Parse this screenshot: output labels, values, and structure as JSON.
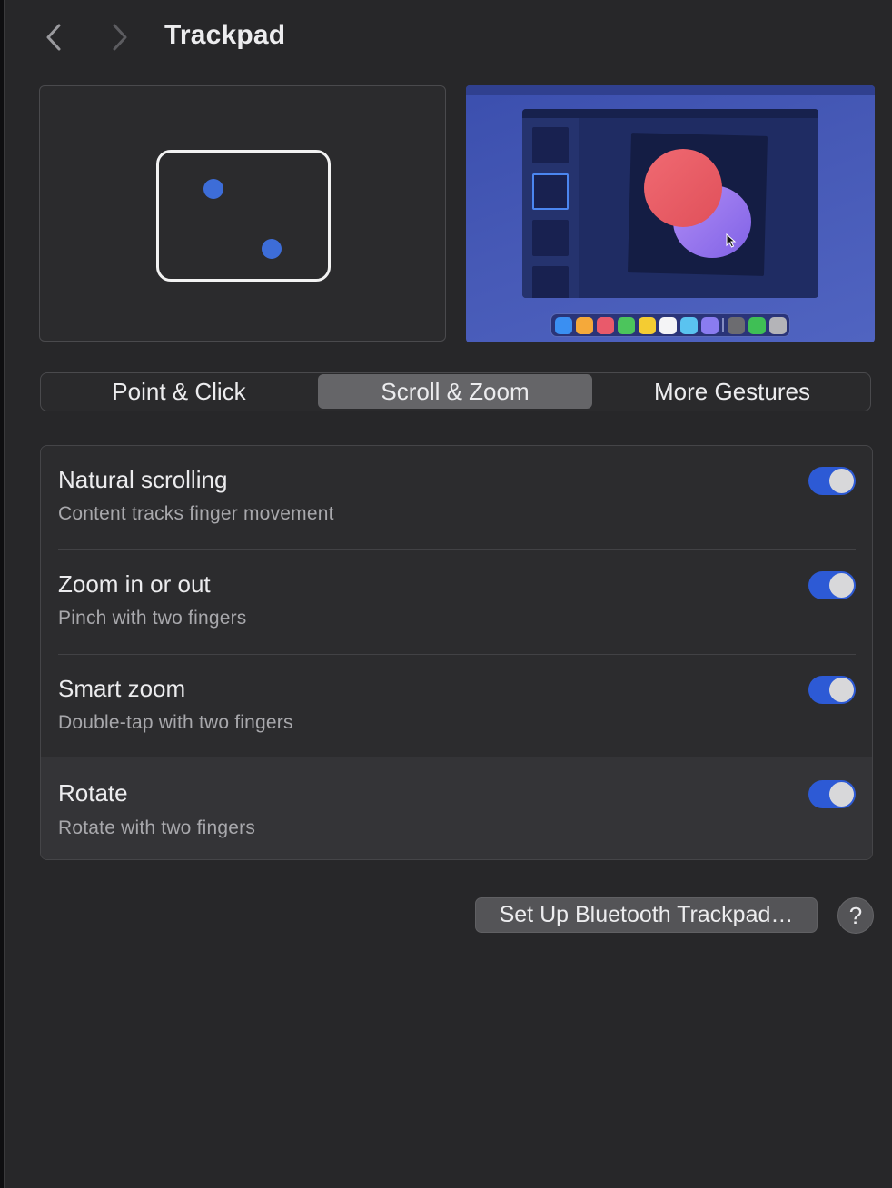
{
  "toolbar": {
    "title": "Trackpad",
    "back_icon": "chevron-left-icon",
    "forward_icon": "chevron-right-icon"
  },
  "tabs": [
    {
      "label": "Point & Click",
      "selected": false
    },
    {
      "label": "Scroll & Zoom",
      "selected": true
    },
    {
      "label": "More Gestures",
      "selected": false
    }
  ],
  "settings": [
    {
      "title": "Natural scrolling",
      "subtitle": "Content tracks finger movement",
      "enabled": true
    },
    {
      "title": "Zoom in or out",
      "subtitle": "Pinch with two fingers",
      "enabled": true
    },
    {
      "title": "Smart zoom",
      "subtitle": "Double-tap with two fingers",
      "enabled": true
    },
    {
      "title": "Rotate",
      "subtitle": "Rotate with two fingers",
      "enabled": true
    }
  ],
  "footer": {
    "bluetooth_button": "Set Up Bluetooth Trackpad…",
    "help_label": "?"
  },
  "colors": {
    "accent": "#2d5ad5",
    "background": "#272729",
    "finger_dot": "#3d6dd8"
  }
}
